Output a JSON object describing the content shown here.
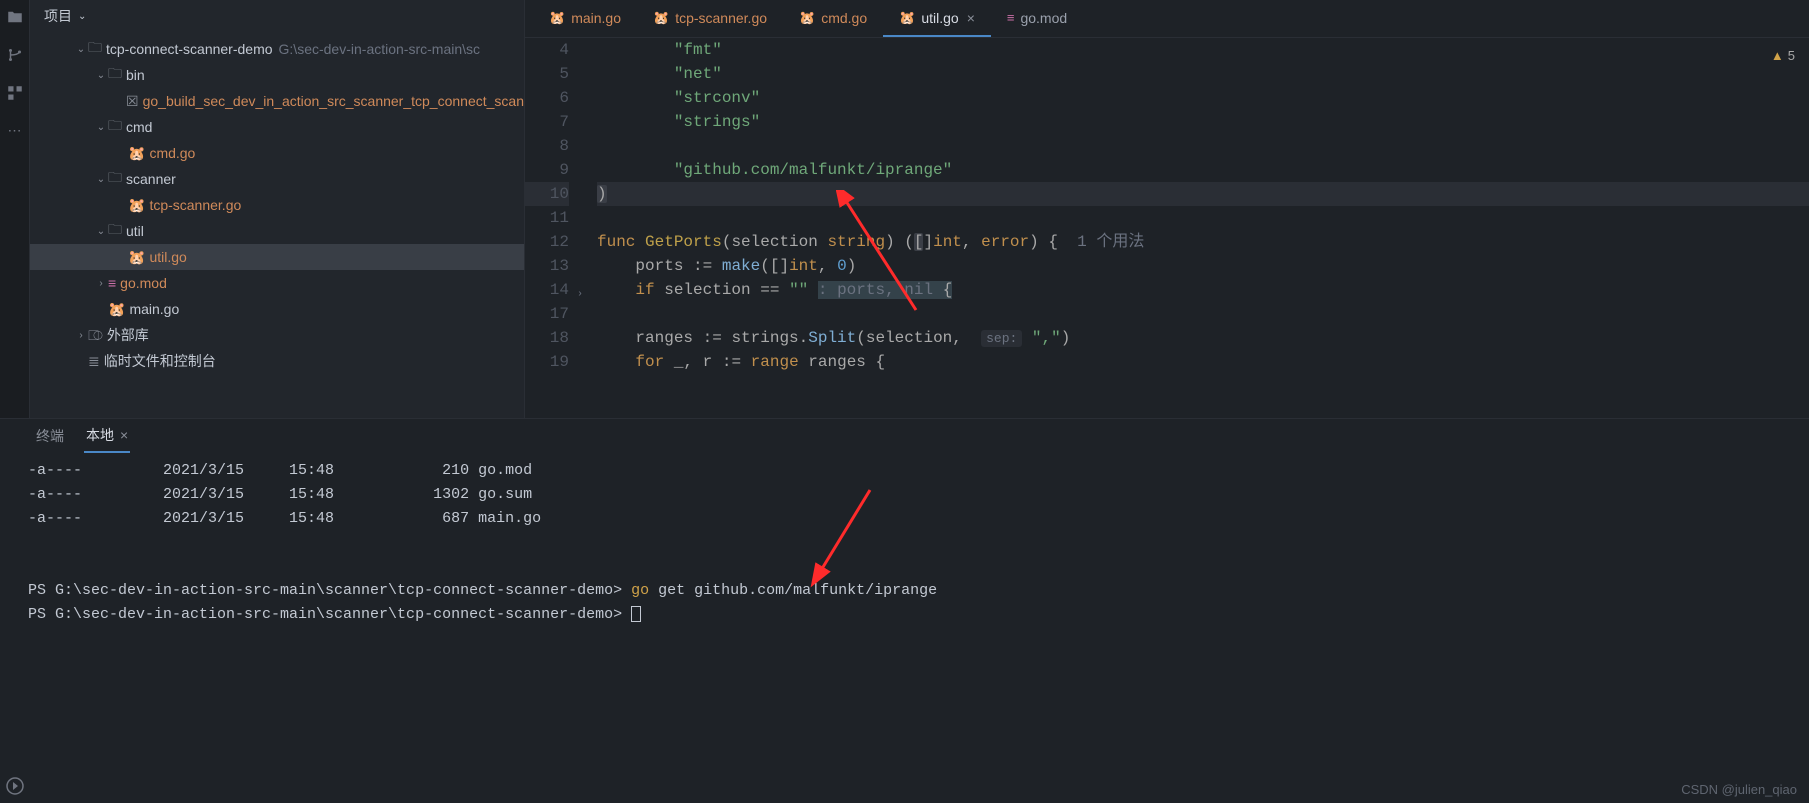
{
  "sidebar": {
    "title": "项目",
    "project": {
      "name": "tcp-connect-scanner-demo",
      "path": "G:\\sec-dev-in-action-src-main\\sc"
    },
    "nodes": {
      "bin": "bin",
      "gobuild": "go_build_sec_dev_in_action_src_scanner_tcp_connect_scan",
      "cmd": "cmd",
      "cmdgo": "cmd.go",
      "scanner": "scanner",
      "tcpscanner": "tcp-scanner.go",
      "util": "util",
      "utilgo": "util.go",
      "gomod": "go.mod",
      "maingo": "main.go",
      "ext": "外部库",
      "scratch": "临时文件和控制台"
    }
  },
  "tabs": {
    "main": "main.go",
    "tcp": "tcp-scanner.go",
    "cmd": "cmd.go",
    "util": "util.go",
    "gomod": "go.mod"
  },
  "warning": {
    "count": "5"
  },
  "code": {
    "l4": "        \"fmt\"",
    "l5": "        \"net\"",
    "l6": "        \"strconv\"",
    "l7": "        \"strings\"",
    "l8": "",
    "l9": "        \"github.com/malfunkt/iprange\"",
    "l10": ")",
    "fn": "GetPorts",
    "usage": "1 个用法",
    "sep_hint": "sep:"
  },
  "lines": {
    "4": "4",
    "5": "5",
    "6": "6",
    "7": "7",
    "8": "8",
    "9": "9",
    "10": "10",
    "11": "11",
    "12": "12",
    "13": "13",
    "14": "14",
    "17": "17",
    "18": "18",
    "19": "19"
  },
  "terminal": {
    "tab1": "终端",
    "tab2": "本地",
    "rows": [
      "-a----         2021/3/15     15:48            210 go.mod",
      "-a----         2021/3/15     15:48           1302 go.sum",
      "-a----         2021/3/15     15:48            687 main.go"
    ],
    "prompt": "PS G:\\sec-dev-in-action-src-main\\scanner\\tcp-connect-scanner-demo> ",
    "cmd_go": "go",
    "cmd_rest": " get github.com/malfunkt/iprange"
  },
  "watermark": "CSDN @julien_qiao"
}
